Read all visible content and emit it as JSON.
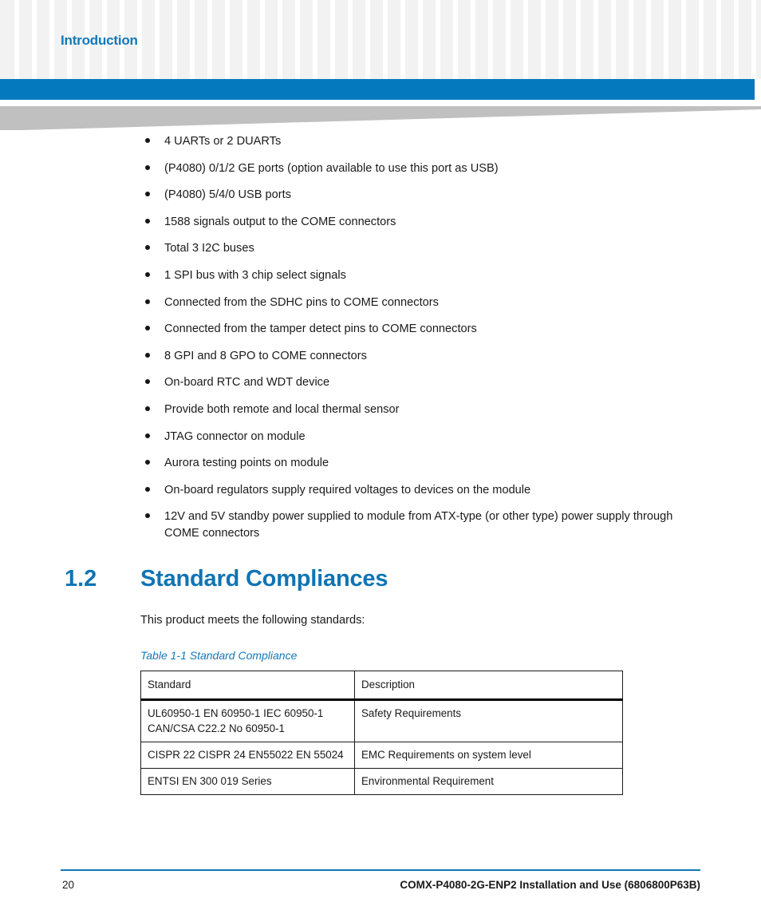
{
  "header": {
    "chapter_label": "Introduction",
    "accent_color": "#0579bd",
    "title_color": "#1479b8",
    "wedge_color": "#c0c0c0",
    "grid_square_color": "#f2f2f2"
  },
  "features": [
    "4 UARTs or 2 DUARTs",
    "(P4080) 0/1/2 GE ports (option available to use this port as USB)",
    "(P4080) 5/4/0 USB ports",
    "1588 signals output to the COME connectors",
    "Total 3 I2C buses",
    "1 SPI bus with 3 chip select signals",
    "Connected from the SDHC pins to COME connectors",
    "Connected from the tamper detect pins to COME connectors",
    "8 GPI and 8 GPO to COME connectors",
    "On-board RTC and WDT device",
    "Provide both remote and local thermal sensor",
    "JTAG connector on module",
    "Aurora testing points on module",
    "On-board regulators supply required voltages to devices on the module",
    "12V and 5V standby power supplied to module from ATX-type (or other type) power supply through COME connectors"
  ],
  "section": {
    "number": "1.2",
    "title": "Standard Compliances",
    "intro": "This product meets the following standards:",
    "heading_color": "#0f74b3"
  },
  "table": {
    "caption": "Table 1-1 Standard Compliance",
    "caption_color": "#1479b8",
    "columns": [
      "Standard",
      "Description"
    ],
    "rows": [
      [
        "UL60950-1 EN 60950-1 IEC 60950-1 CAN/CSA C22.2 No 60950-1",
        "Safety Requirements"
      ],
      [
        "CISPR 22 CISPR 24 EN55022 EN 55024",
        "EMC Requirements on system level"
      ],
      [
        "ENTSI EN 300 019 Series",
        "Environmental Requirement"
      ]
    ]
  },
  "footer": {
    "page_number": "20",
    "document_title": "COMX-P4080-2G-ENP2 Installation and Use (6806800P63B)",
    "rule_color": "#1479b8"
  }
}
